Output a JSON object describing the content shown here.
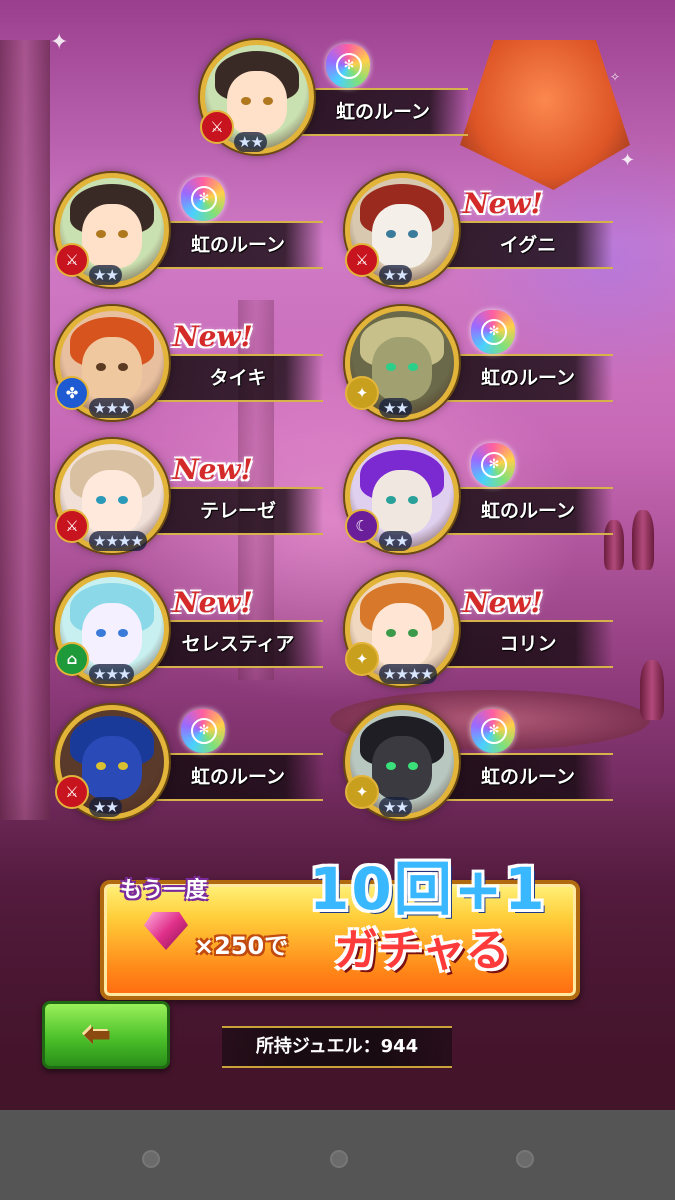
{
  "results": [
    {
      "label": "虹のルーン",
      "is_new": false,
      "reward": "rainbow-rune",
      "stars": "★★",
      "element": "fire",
      "portrait": "elf-girl"
    },
    {
      "label": "虹のルーン",
      "is_new": false,
      "reward": "rainbow-rune",
      "stars": "★★",
      "element": "fire",
      "portrait": "elf-girl"
    },
    {
      "label": "イグニ",
      "is_new": true,
      "reward": "new-unit",
      "stars": "★★",
      "element": "fire",
      "portrait": "cat-beast"
    },
    {
      "label": "タイキ",
      "is_new": true,
      "reward": "new-unit",
      "stars": "★★★",
      "element": "water",
      "portrait": "bandana-man"
    },
    {
      "label": "虹のルーン",
      "is_new": false,
      "reward": "rainbow-rune",
      "stars": "★★",
      "element": "earth",
      "portrait": "gold-knight"
    },
    {
      "label": "テレーゼ",
      "is_new": true,
      "reward": "new-unit",
      "stars": "★★★★",
      "element": "fire",
      "portrait": "bow-girl"
    },
    {
      "label": "虹のルーン",
      "is_new": false,
      "reward": "rainbow-rune",
      "stars": "★★",
      "element": "dark",
      "portrait": "cat-mage"
    },
    {
      "label": "セレスティア",
      "is_new": true,
      "reward": "new-unit",
      "stars": "★★★",
      "element": "wind",
      "portrait": "ice-maiden"
    },
    {
      "label": "コリン",
      "is_new": true,
      "reward": "new-unit",
      "stars": "★★★★",
      "element": "earth",
      "portrait": "fox-girl"
    },
    {
      "label": "虹のルーン",
      "is_new": false,
      "reward": "rainbow-rune",
      "stars": "★★",
      "element": "fire",
      "portrait": "blue-knight"
    },
    {
      "label": "虹のルーン",
      "is_new": false,
      "reward": "rainbow-rune",
      "stars": "★★",
      "element": "earth",
      "portrait": "black-cat"
    }
  ],
  "new_label": "New!",
  "gacha_button": {
    "again": "もう一度",
    "count": "10回+1",
    "cost": "×250で",
    "action": "ガチャる"
  },
  "jewels_text": "所持ジュエル：944",
  "back_icon": "left-arrow-icon",
  "colors": {
    "gold": "#e3b43a",
    "fire": "#c8141e",
    "water": "#1e5ad2",
    "wind": "#1e9a3a",
    "earth": "#c8a01e",
    "dark": "#6a1e9a",
    "new": "#d42a2a",
    "back": "#4cc12a"
  }
}
